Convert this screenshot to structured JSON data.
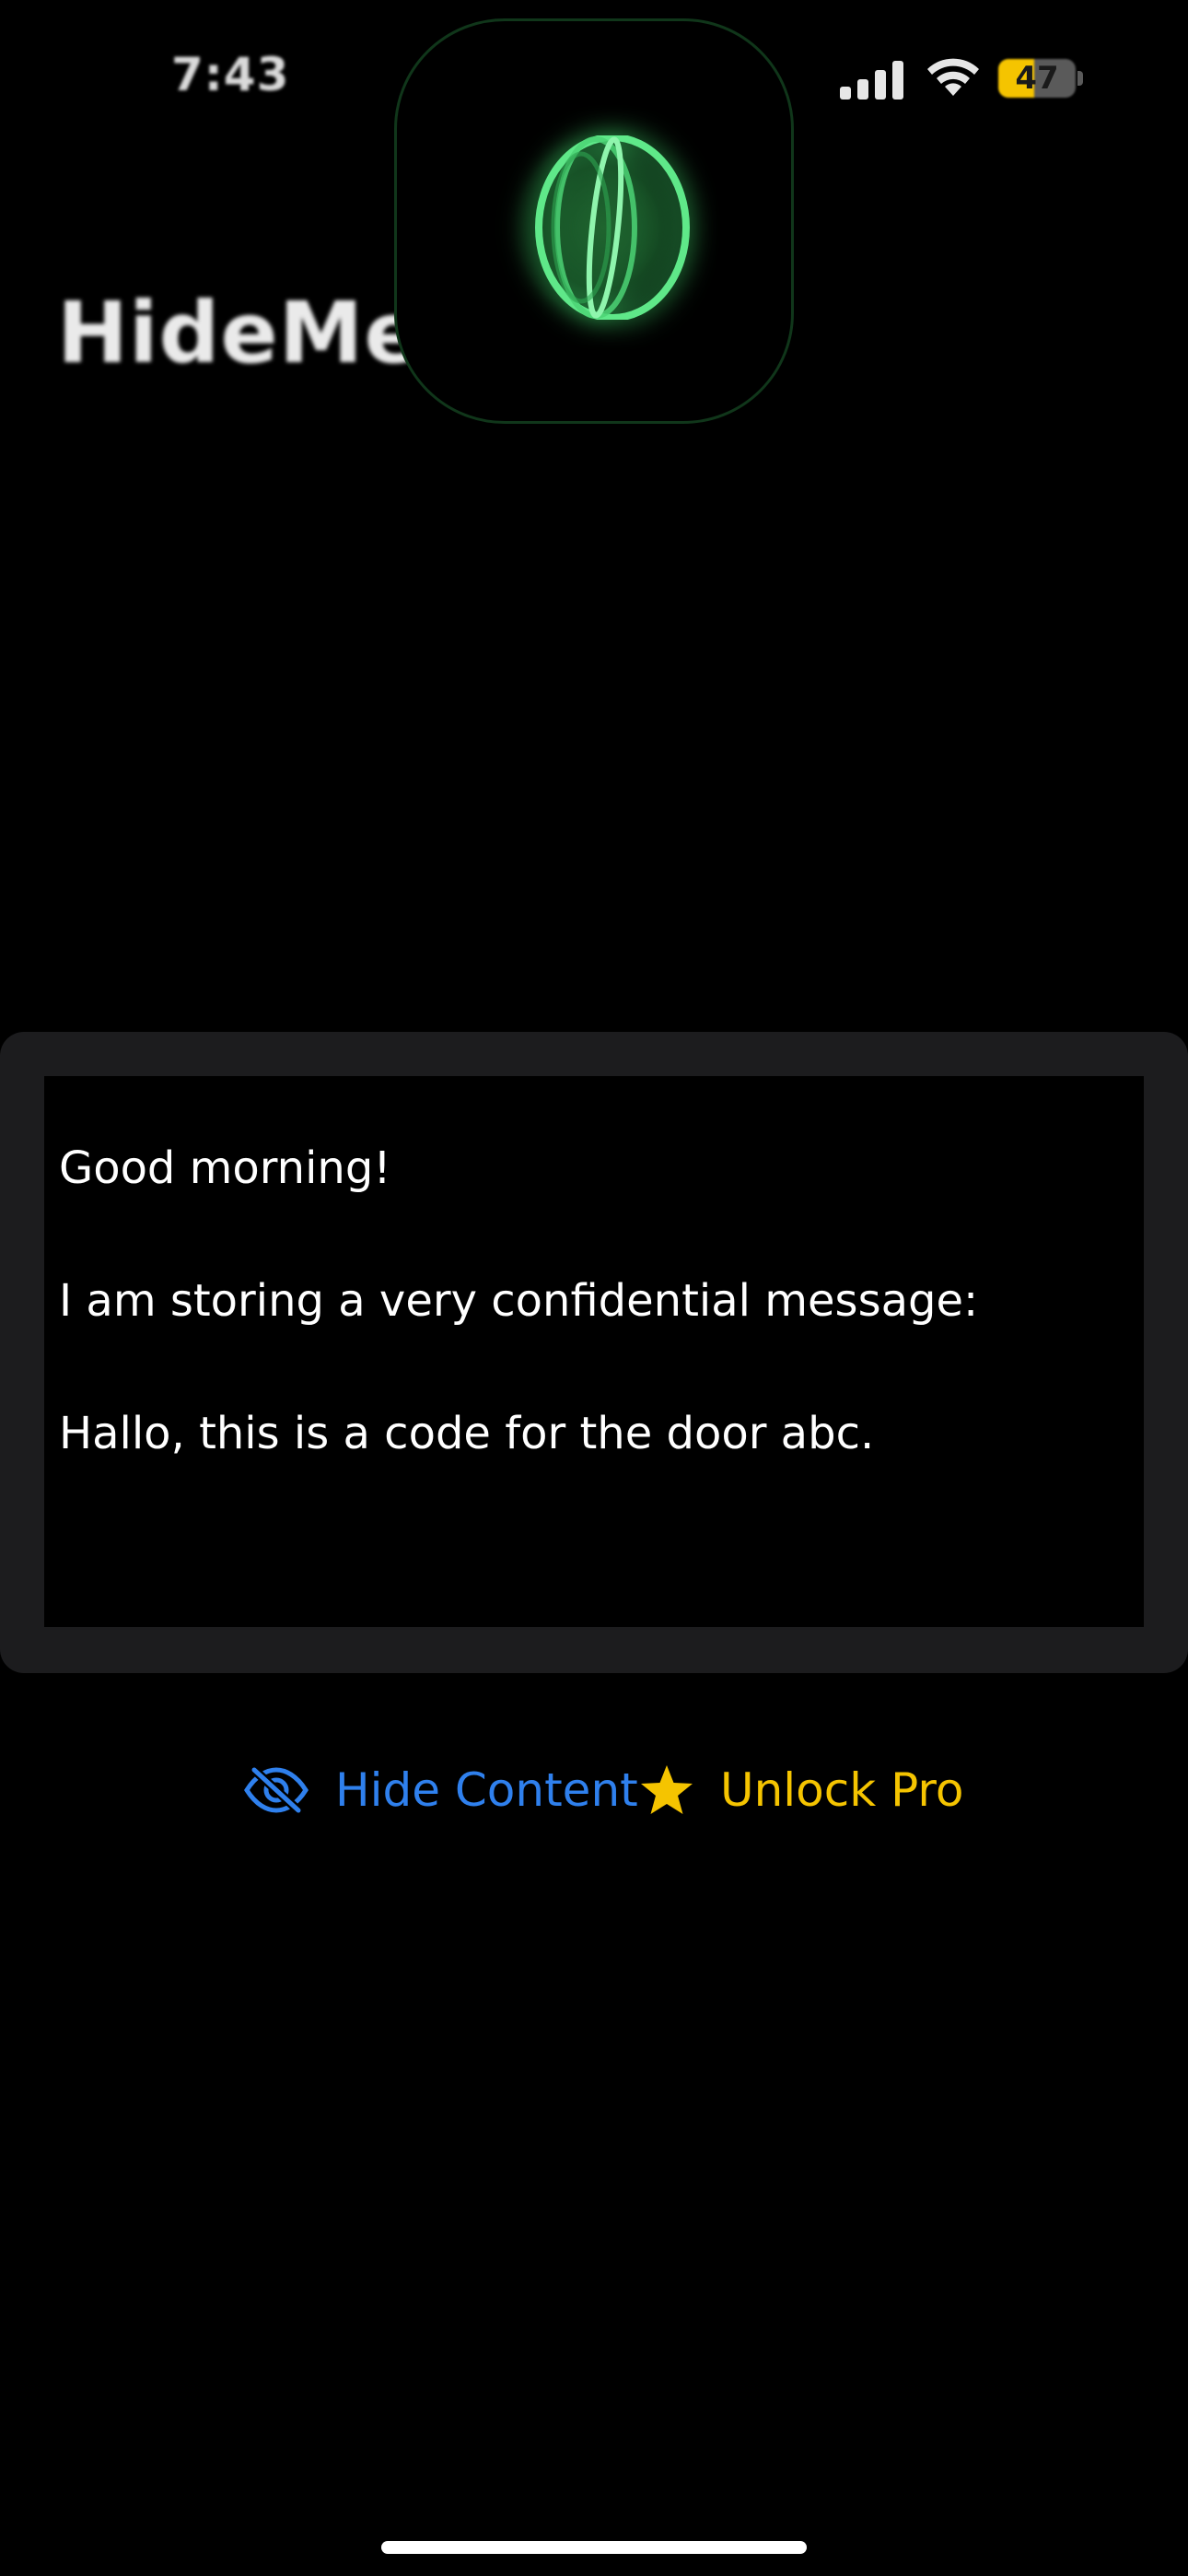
{
  "status_bar": {
    "time": "7:43",
    "battery_level": "47",
    "battery_fraction": 0.47,
    "battery_color": "#f5c400",
    "signal_icon": "cellular-signal-icon",
    "wifi_icon": "wifi-icon"
  },
  "app": {
    "title": "HideMe",
    "island_icon": "glowing-orb-icon",
    "accent_green": "#3fd66a"
  },
  "editor": {
    "lines": [
      "Good morning!",
      "I am storing a very confidential message:",
      "Hallo, this is a code for the door abc."
    ]
  },
  "actions": {
    "hide_label": "Hide Content",
    "hide_icon": "eye-slash-icon",
    "hide_color": "#2f80ed",
    "pro_label": "Unlock Pro",
    "pro_icon": "star-icon",
    "pro_color": "#f5c400"
  }
}
